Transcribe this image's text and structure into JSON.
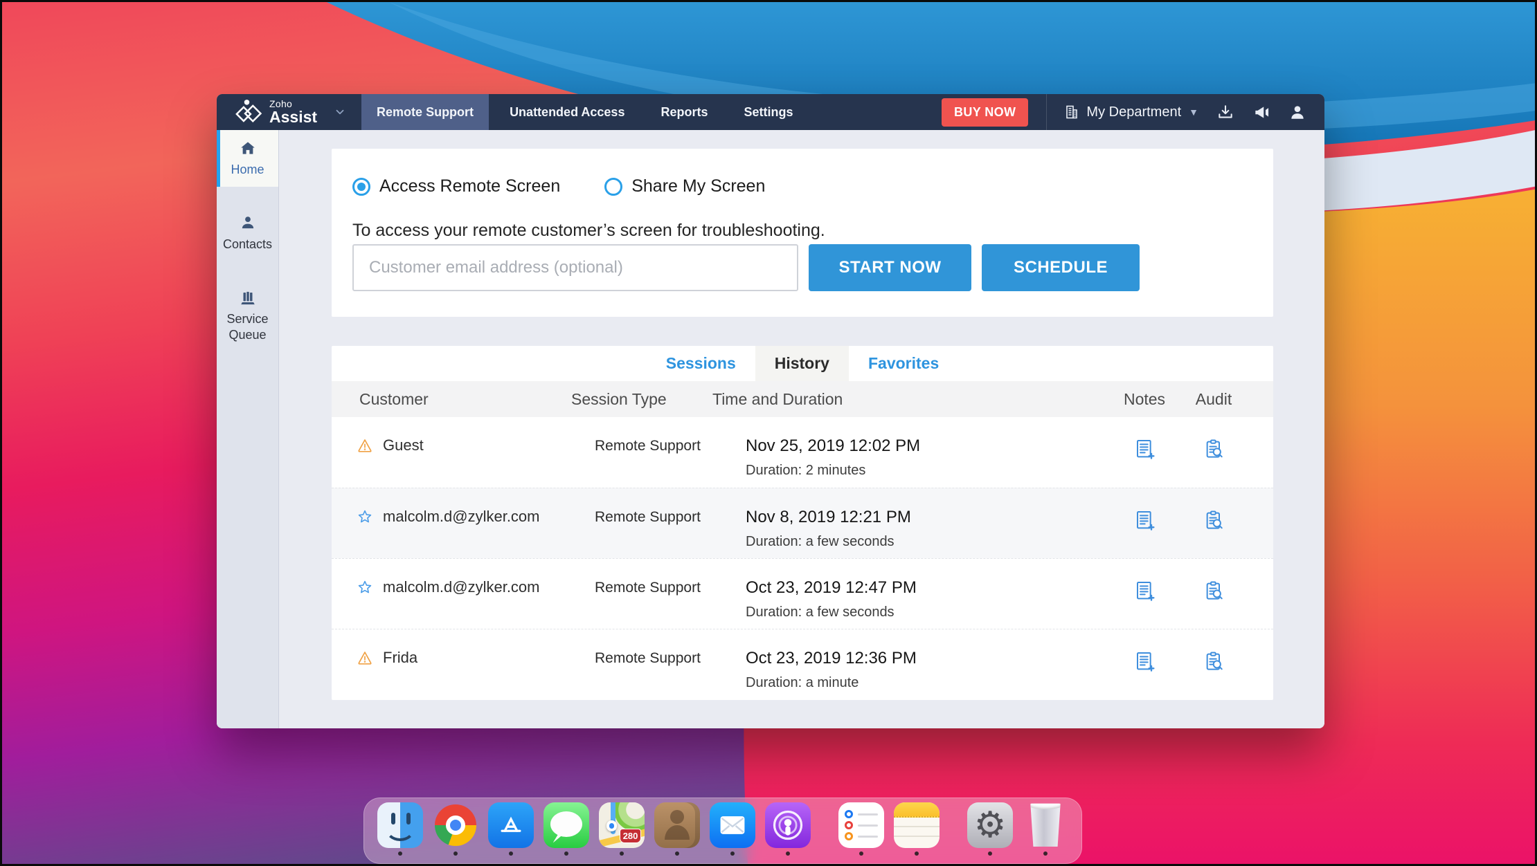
{
  "window": {
    "navbar": {
      "logo_top": "Zoho",
      "logo_name": "Assist",
      "tabs": [
        {
          "label": "Remote Support",
          "active": true
        },
        {
          "label": "Unattended Access",
          "active": false
        },
        {
          "label": "Reports",
          "active": false
        },
        {
          "label": "Settings",
          "active": false
        }
      ],
      "buy_now_label": "BUY NOW",
      "department_label": "My Department"
    },
    "sidebar": {
      "items": [
        {
          "label": "Home",
          "active": true
        },
        {
          "label": "Contacts",
          "active": false
        },
        {
          "label": "Service Queue",
          "active": false
        }
      ]
    },
    "session_panel": {
      "radio_access": "Access Remote Screen",
      "radio_share": "Share My Screen",
      "selected_radio": "Access Remote Screen",
      "description": "To access your remote customer’s screen for troubleshooting.",
      "email_placeholder": "Customer email address (optional)",
      "email_value": "",
      "start_button": "START NOW",
      "schedule_button": "SCHEDULE"
    },
    "history_panel": {
      "tabs": [
        "Sessions",
        "History",
        "Favorites"
      ],
      "active_tab": "History",
      "columns": [
        "Customer",
        "Session Type",
        "Time and Duration",
        "Notes",
        "Audit"
      ],
      "rows": [
        {
          "icon": "warning",
          "customer": "Guest",
          "session_type": "Remote Support",
          "time": "Nov 25, 2019 12:02 PM",
          "duration": "Duration: 2 minutes"
        },
        {
          "icon": "favorite-star",
          "customer": "malcolm.d@zylker.com",
          "session_type": "Remote Support",
          "time": "Nov 8, 2019 12:21 PM",
          "duration": "Duration: a few seconds"
        },
        {
          "icon": "favorite-star",
          "customer": "malcolm.d@zylker.com",
          "session_type": "Remote Support",
          "time": "Oct 23, 2019 12:47 PM",
          "duration": "Duration: a few seconds"
        },
        {
          "icon": "warning",
          "customer": "Frida",
          "session_type": "Remote Support",
          "time": "Oct 23, 2019 12:36 PM",
          "duration": "Duration: a minute"
        }
      ]
    }
  },
  "dock": {
    "apps": [
      "Finder",
      "Chrome",
      "App Store",
      "Messages",
      "Maps",
      "Contacts",
      "Mail",
      "Podcasts",
      "Reminders",
      "Notes",
      "System Preferences",
      "Trash"
    ],
    "maps_badge": "280"
  },
  "colors": {
    "navbar_bg": "#26344e",
    "navbar_active_tab": "#4f6089",
    "buy_now_red": "#f0534f",
    "accent_blue": "#3095d8",
    "link_blue": "#2e94df",
    "radio_blue": "#2aa0e8",
    "sidebar_active_border": "#23a3ef",
    "warning_orange": "#f0a144",
    "content_bg": "#e9ebf2"
  }
}
